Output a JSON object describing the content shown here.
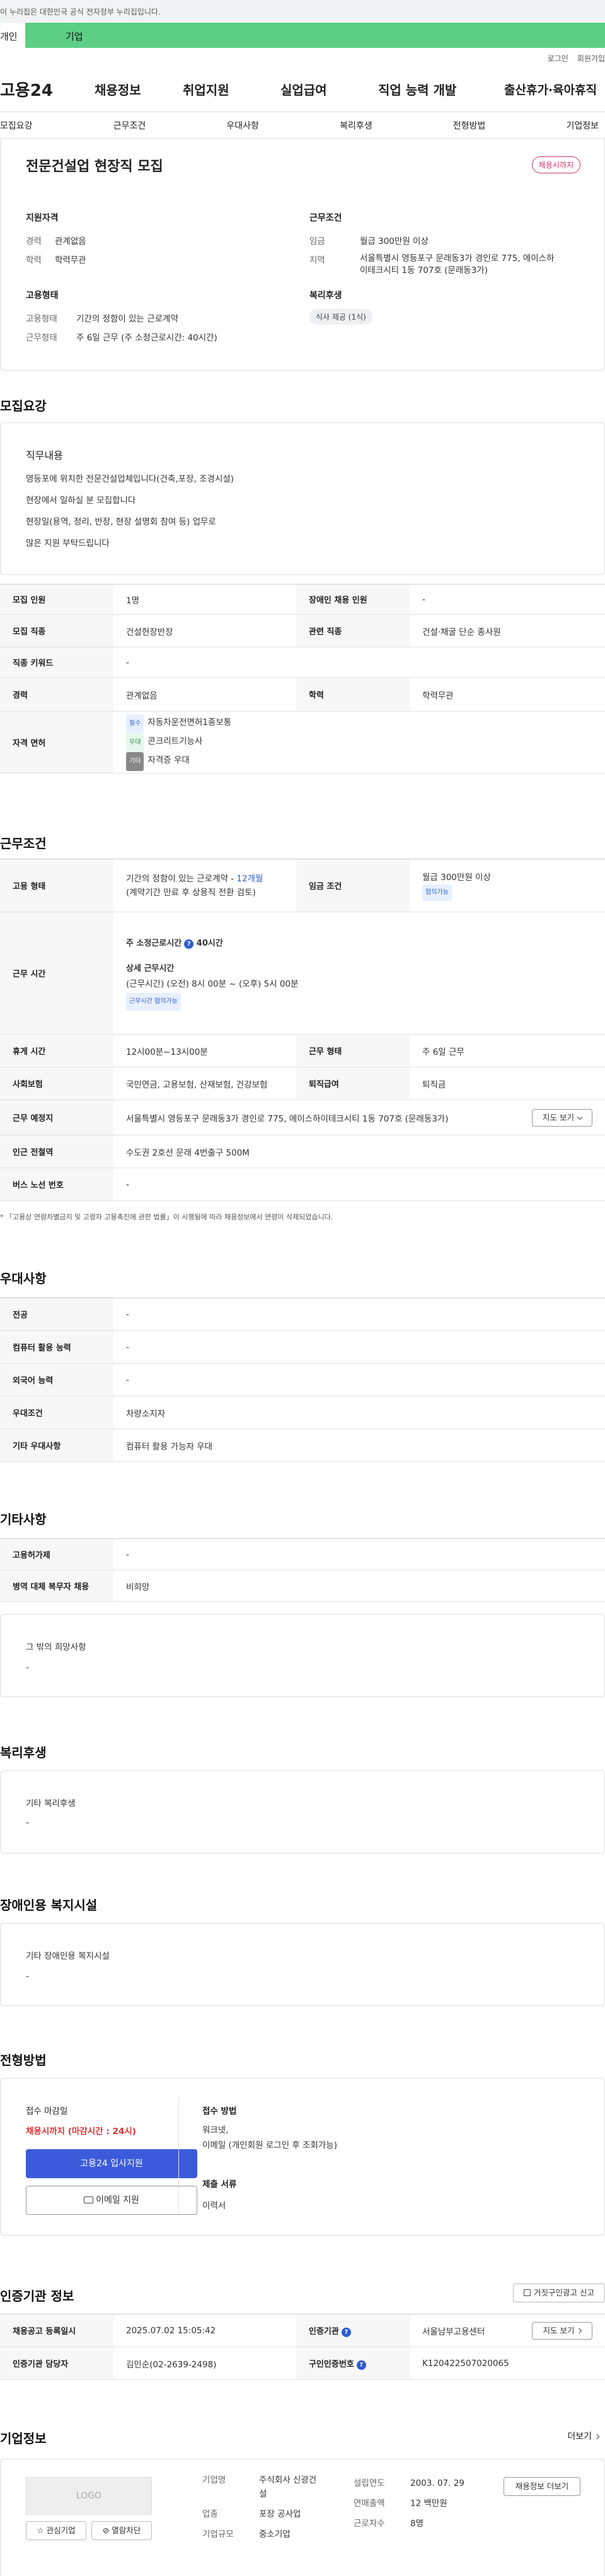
{
  "gov_notice": "이 누리집은 대한민국 공식 전자정부 누리집입니다.",
  "user_tabs": [
    "개인",
    "기업"
  ],
  "util": [
    "로그인",
    "회원가입"
  ],
  "logo": "고용24",
  "gnb": [
    "채용정보",
    "취업지원",
    "실업급여",
    "직업 능력 개발",
    "출산휴가·육아휴직"
  ],
  "anchors": [
    "모집요강",
    "근무조건",
    "우대사항",
    "복리후생",
    "전형방법",
    "기업정보"
  ],
  "job": {
    "title": "전문건설업 현장직 모집",
    "status": "채용시까지",
    "qual_label": "지원자격",
    "career_k": "경력",
    "career_v": "관계없음",
    "edu_k": "학력",
    "edu_v": "학력무관",
    "emp_label": "고용형태",
    "emp_k": "고용형태",
    "emp_v": "기간의 정함이 있는 근로계약",
    "work_k": "근무형태",
    "work_v": "주 6일 근무 (주 소정근로시간: 40시간)",
    "cond_label": "근무조건",
    "wage_k": "임금",
    "wage_v": "월급 300만원 이상",
    "area_k": "지역",
    "area_v1": "서울특별시 영등포구 문래동3가 경인로 775, 에이스하",
    "area_v2": "이테크시티 1동 707호 (문래동3가)",
    "welfare_label": "복리후생",
    "welfare_tag": "식사 제공 (1식)"
  },
  "recruit": {
    "heading": "모집요강",
    "duty_label": "직무내용",
    "duty_lines": [
      "영등포에 위치한 전문건설업체입니다(건축,포장, 조경시설)",
      "현장에서 일하실 분 모집합니다",
      "현장일(용역, 정리, 반장, 현장 설명회 참여 등)  업무로",
      "많은 지원 부탁드립니다"
    ],
    "rows": {
      "count_h": "모집 인원",
      "count_v": "1명",
      "disabled_h": "장애인 채용 인원",
      "disabled_v": "-",
      "job_h": "모집 직종",
      "job_v": "건설현장반장",
      "rel_h": "관련 직종",
      "rel_v": "건설·채굴 단순 종사원",
      "kw_h": "직종 키워드",
      "kw_v": "-",
      "career_h": "경력",
      "career_v": "관계없음",
      "edu_h": "학력",
      "edu_v": "학력무관",
      "lic_h": "자격 면허",
      "lic": [
        {
          "badge": "필수",
          "text": "자동차운전면허1종보통"
        },
        {
          "badge": "우대",
          "text": "콘크리트기능사"
        },
        {
          "badge": "기타",
          "text": "자격증 우대"
        }
      ]
    }
  },
  "conditions": {
    "heading": "근무조건",
    "emp_h": "고용 형태",
    "emp_v1": "기간의 정함이 있는 근로계약 - ",
    "emp_months": "12개월",
    "emp_v2": "(계약기간 만료 후 상용직 전환 검토)",
    "wage_h": "임금 조건",
    "wage_v": "월급 300만원 이상",
    "wage_tag": "협의가능",
    "hours_h": "근무 시간",
    "hours_title": "주 소정근로시간",
    "hours_num": "40시간",
    "detail_label": "상세 근무시간",
    "detail_v": "(근무시간) (오전) 8시 00분 ~ (오후) 5시 00분",
    "detail_tag": "근무시간 협의가능",
    "rest_h": "휴게 시간",
    "rest_v": "12시00분~13시00분",
    "form_h": "근무 형태",
    "form_v": "주 6일 근무",
    "ins_h": "사회보험",
    "ins_v": "국민연금, 고용보험, 산재보험, 건강보험",
    "ret_h": "퇴직급여",
    "ret_v": "퇴직금",
    "loc_h": "근무 예정지",
    "loc_v": "서울특별시 영등포구 문래동3가 경인로 775, 에이스하이테크시티 1동 707호 (문래동3가)",
    "map_btn": "지도 보기",
    "station_h": "인근 전철역",
    "station_v": "수도권 2호선 문래 4번출구 500M",
    "bus_h": "버스 노선 번호",
    "bus_v": "-",
    "note": "* 「고용상 연령차별금지 및 고령자 고용촉진에 관한 법률」이 시행됨에 따라 채용정보에서 연령이 삭제되었습니다."
  },
  "prefer": {
    "heading": "우대사항",
    "rows": [
      [
        "전공",
        "-"
      ],
      [
        "컴퓨터 활용 능력",
        "-"
      ],
      [
        "외국어 능력",
        "-"
      ],
      [
        "우대조건",
        "차량소지자"
      ],
      [
        "기타 우대사항",
        "컴퓨터 활용 가능자 우대"
      ]
    ]
  },
  "etc": {
    "heading": "기타사항",
    "rows": [
      [
        "고용허가제",
        "-"
      ],
      [
        "병역 대체 복무자 채용",
        "비희망"
      ]
    ],
    "wish_label": "그 밖의 희망사항",
    "wish_v": "-"
  },
  "welfare": {
    "heading": "복리후생",
    "label": "기타 복리후생",
    "v": "-"
  },
  "disability": {
    "heading": "장애인용 복지시설",
    "label": "기타 장애인용 복지시설",
    "v": "-"
  },
  "selection": {
    "heading": "전형방법",
    "deadline_label": "접수 마감일",
    "deadline_v": "채용시까지 (마감시간 : 24시)",
    "apply_btn": "고용24 입사지원",
    "email_btn": "이메일 지원",
    "method_label": "접수 방법",
    "method_v1": "워크넷,",
    "method_v2": "이메일 (개인회원 로그인 후 조회가능)",
    "docs_label": "제출 서류",
    "docs_v": "이력서"
  },
  "agency": {
    "heading": "인증기관 정보",
    "report_btn": "거짓구인광고 신고",
    "reg_h": "채용공고 등록일시",
    "reg_v": "2025.07.02 15:05:42",
    "org_h": "인증기관",
    "org_v": "서울남부고용센터",
    "map_btn": "지도 보기",
    "mgr_h": "인증기관 담당자",
    "mgr_v": "김민순(02-2639-2498)",
    "num_h": "구인인증번호",
    "num_v": "K120422507020065"
  },
  "company": {
    "heading": "기업정보",
    "more": "더보기",
    "logo": "LOGO",
    "fav_btn": "관심기업",
    "block_btn": "열람차단",
    "name_k": "기업명",
    "name_v1": "주식회사 신광건",
    "name_v2": "설",
    "biz_k": "업종",
    "biz_v": "포장 공사업",
    "size_k": "기업규모",
    "size_v": "중소기업",
    "year_k": "설립연도",
    "year_v": "2003. 07. 29",
    "sales_k": "연매출액",
    "sales_v": "12 백만원",
    "emp_k": "근로자수",
    "emp_v": "8명",
    "jobs_btn": "채용정보 더보기"
  }
}
